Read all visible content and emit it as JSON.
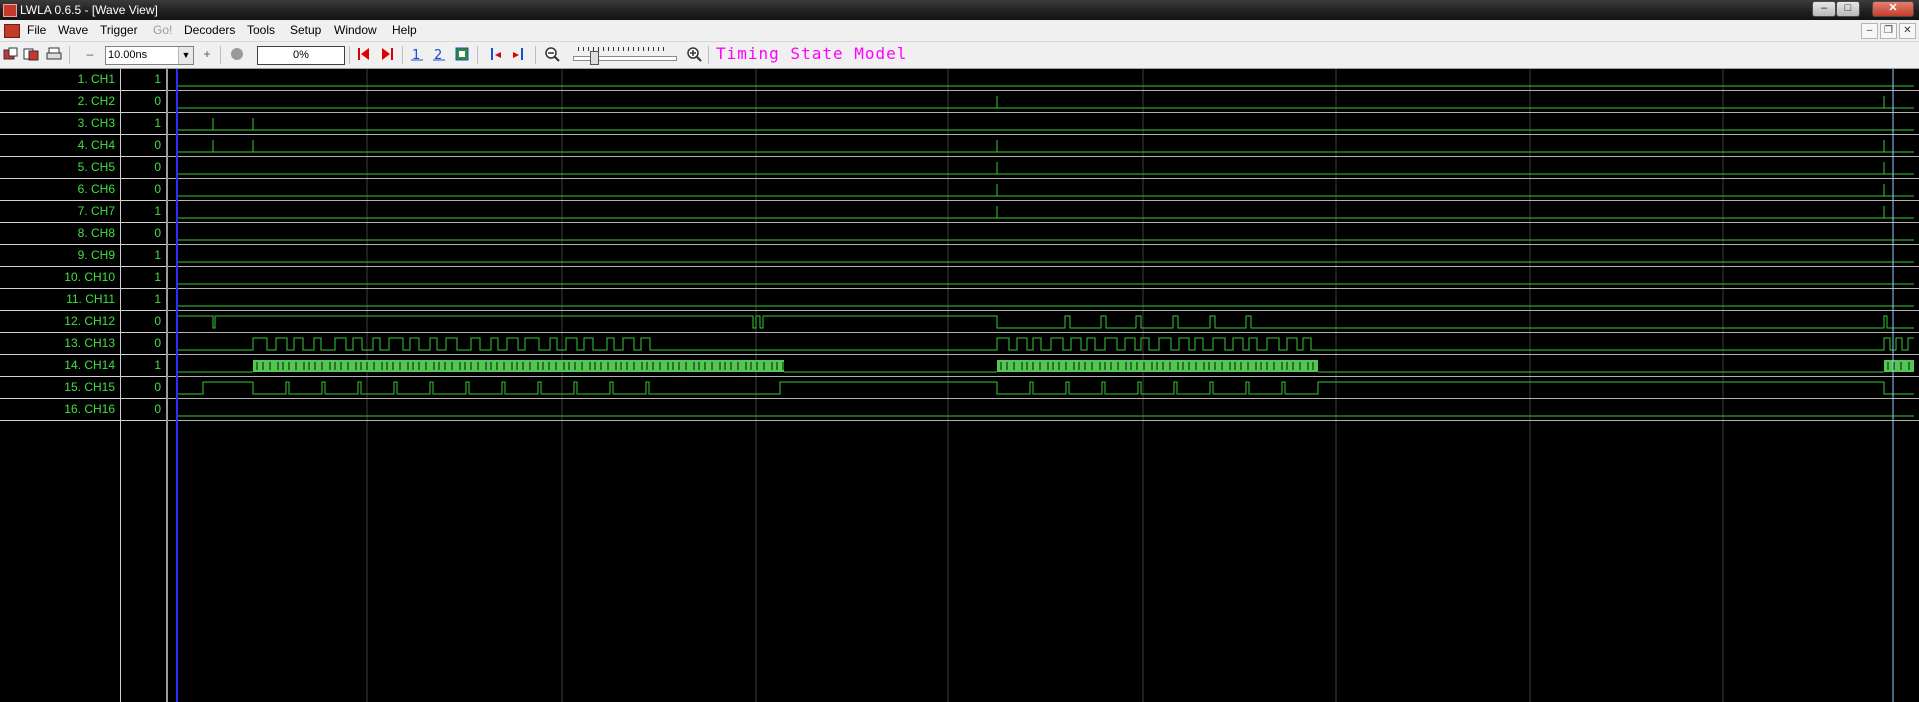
{
  "window": {
    "title": "LWLA 0.6.5 - [Wave View]",
    "minimize_label": "–",
    "maximize_label": "□",
    "close_label": "✕"
  },
  "menu": {
    "items": [
      "File",
      "Wave",
      "Trigger",
      "Go!",
      "Decoders",
      "Tools",
      "Setup",
      "Window",
      "Help"
    ],
    "disabled": [
      "Go!"
    ],
    "mdi_buttons": [
      "–",
      "❐",
      "✕"
    ]
  },
  "toolbar": {
    "zoom_out_label": "–",
    "zoom_in_label": "+",
    "timescale_value": "10.00ns",
    "progress_value": "0%",
    "mode_label": "Timing State Model"
  },
  "channels": [
    {
      "name": "1. CH1",
      "value": "1"
    },
    {
      "name": "2. CH2",
      "value": "0"
    },
    {
      "name": "3. CH3",
      "value": "1"
    },
    {
      "name": "4. CH4",
      "value": "0"
    },
    {
      "name": "5. CH5",
      "value": "0"
    },
    {
      "name": "6. CH6",
      "value": "0"
    },
    {
      "name": "7. CH7",
      "value": "1"
    },
    {
      "name": "8. CH8",
      "value": "0"
    },
    {
      "name": "9. CH9",
      "value": "1"
    },
    {
      "name": "10. CH10",
      "value": "1"
    },
    {
      "name": "11. CH11",
      "value": "1"
    },
    {
      "name": "12. CH12",
      "value": "0"
    },
    {
      "name": "13. CH13",
      "value": "0"
    },
    {
      "name": "14. CH14",
      "value": "1"
    },
    {
      "name": "15. CH15",
      "value": "0"
    },
    {
      "name": "16. CH16",
      "value": "0"
    }
  ],
  "colors": {
    "trace": "#39c739",
    "dense_fill": "#52c852",
    "grid": "#3c3c3c",
    "row_line": "#d2d2d2",
    "cursor_left": "#2c2cff",
    "cursor_right": "#8ed0ff",
    "mode_label": "#ff00ff"
  }
}
